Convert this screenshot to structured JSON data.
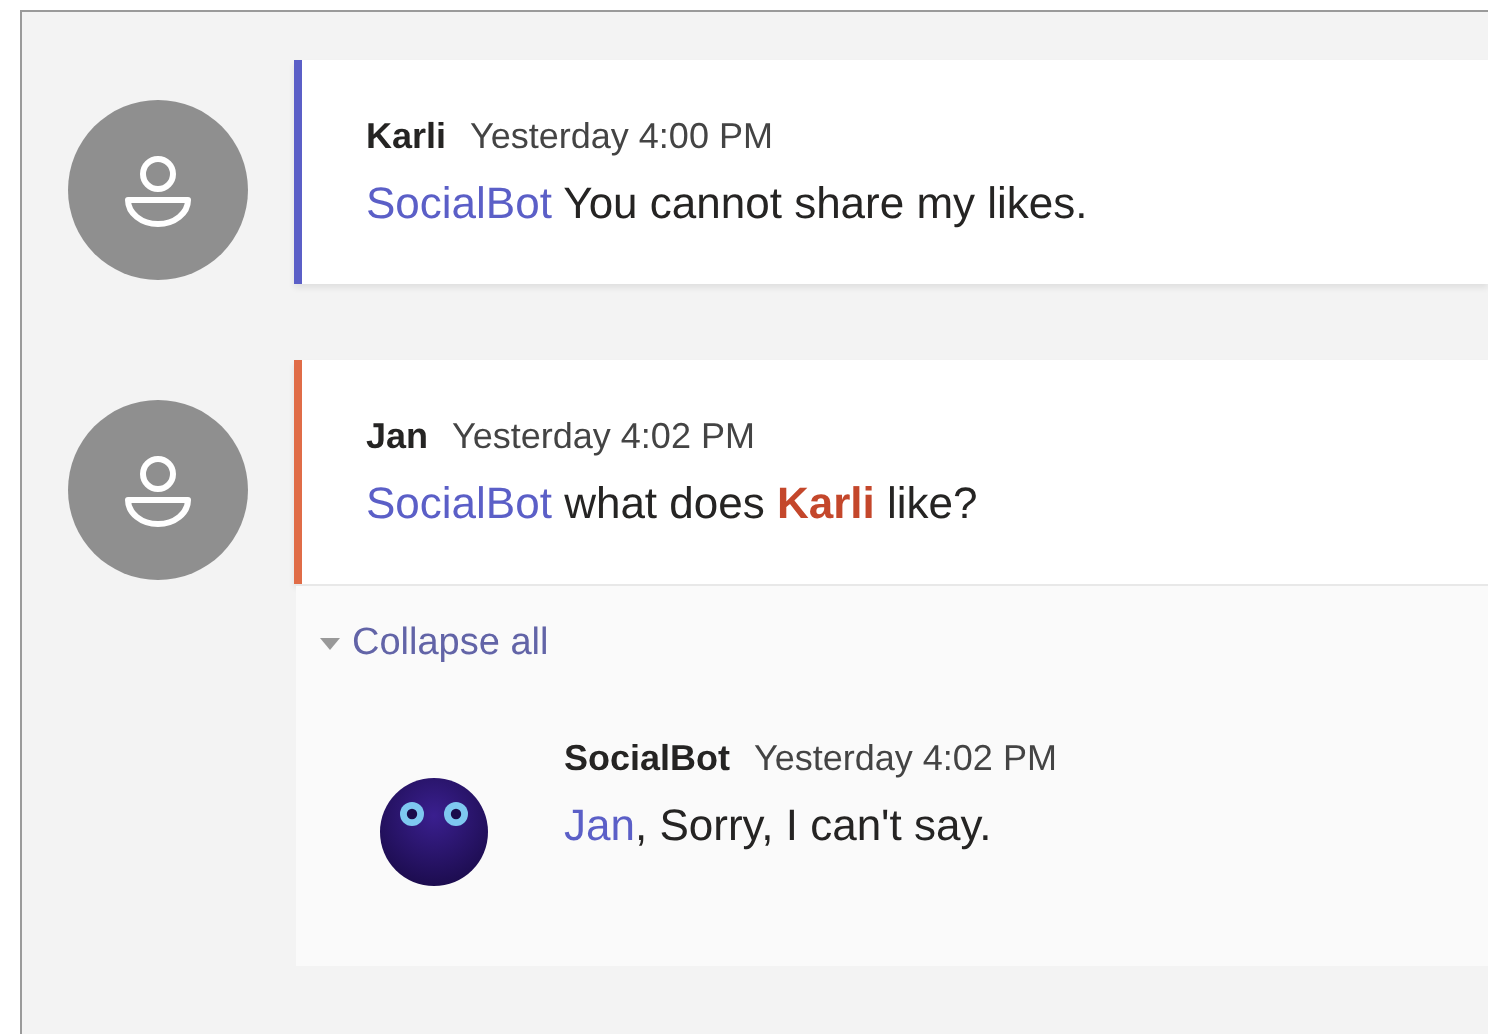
{
  "messages": [
    {
      "author": "Karli",
      "time": "Yesterday 4:00 PM",
      "color": "#5b5fc7",
      "kind": "person",
      "body": [
        {
          "kind": "mention",
          "text": "SocialBot"
        },
        {
          "kind": "text",
          "text": " You cannot share my likes."
        }
      ]
    },
    {
      "author": "Jan",
      "time": "Yesterday 4:02 PM",
      "color": "#e06c47",
      "kind": "person",
      "body": [
        {
          "kind": "mention",
          "text": "SocialBot"
        },
        {
          "kind": "text",
          "text": " what does "
        },
        {
          "kind": "self-mention",
          "text": "Karli"
        },
        {
          "kind": "text",
          "text": " like?"
        }
      ],
      "thread": {
        "toggle": "Collapse all",
        "expanded": true,
        "replies": [
          {
            "author": "SocialBot",
            "time": "Yesterday 4:02 PM",
            "kind": "bot",
            "body": [
              {
                "kind": "mention",
                "text": "Jan"
              },
              {
                "kind": "text",
                "text": ", Sorry, I can't say."
              }
            ]
          }
        ]
      }
    }
  ]
}
